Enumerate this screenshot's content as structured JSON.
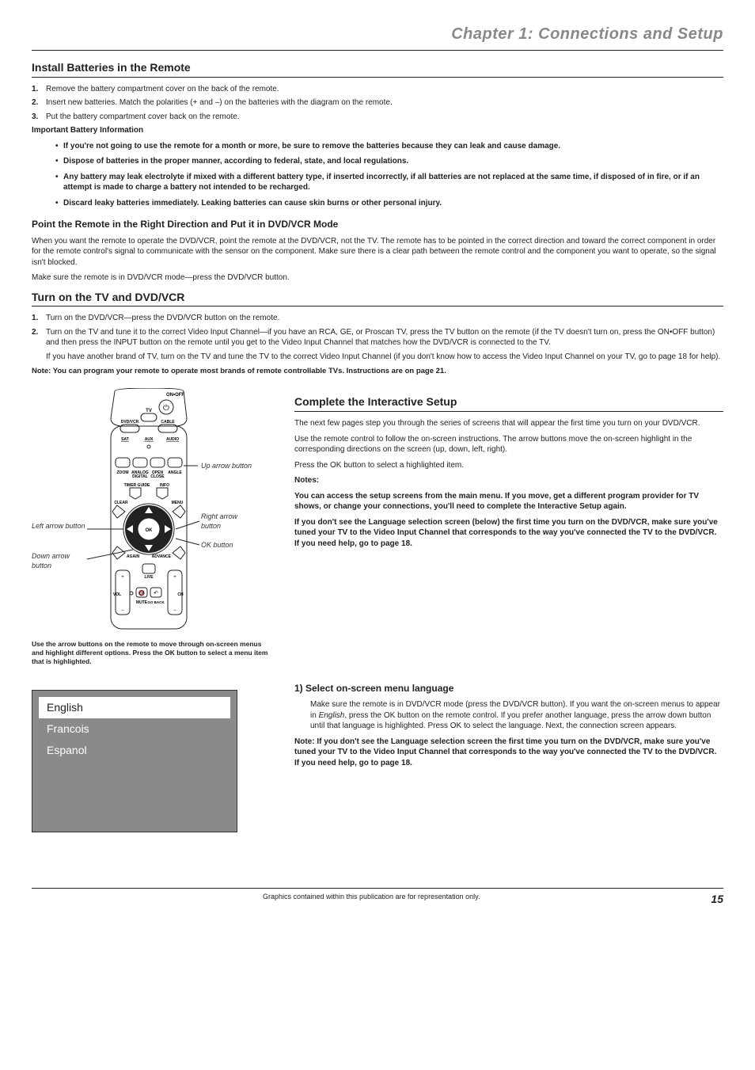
{
  "chapter_title": "Chapter 1: Connections and Setup",
  "sec1": {
    "heading": "Install Batteries in the Remote",
    "steps": [
      "Remove the battery compartment cover on the back of the remote.",
      "Insert new batteries. Match the polarities (+ and –) on the batteries with the diagram on the remote.",
      "Put the battery compartment cover back on the remote."
    ],
    "info_head": "Important Battery Information",
    "bullets": [
      "If you're not going to use the remote for a month or more, be sure to remove the batteries because they can leak and cause damage.",
      "Dispose of batteries in the proper manner, according to federal, state, and local regulations.",
      "Any battery may leak electrolyte if mixed with a different battery type, if inserted incorrectly, if all batteries are not replaced at the same time, if disposed of in fire, or if an attempt is made to charge a battery not intended to be recharged.",
      "Discard leaky batteries immediately. Leaking batteries can cause skin burns or other personal injury."
    ],
    "point_head": "Point the Remote in the Right Direction and Put it in DVD/VCR Mode",
    "point_p1": "When you want the remote to operate the DVD/VCR, point the remote at the DVD/VCR, not the TV. The remote has to be pointed in the correct direction and toward the correct component in order for the remote control's signal to communicate with the sensor on the component. Make sure there is a clear path between the remote control and the component you want to operate, so the signal isn't blocked.",
    "point_p2": "Make sure the remote is in DVD/VCR mode—press the DVD/VCR button."
  },
  "sec2": {
    "heading": "Turn on the TV and DVD/VCR",
    "step1": "Turn on the DVD/VCR—press the DVD/VCR button on the remote.",
    "step2": "Turn on the TV and tune it to the correct Video Input Channel—if you have an RCA, GE, or Proscan TV, press the TV button on the remote (if the TV doesn't turn on, press the ON•OFF button) and then press the INPUT button on the remote until you get to the Video Input Channel that matches how the DVD/VCR is connected to the TV.",
    "step2b": "If you have another brand of TV, turn on the TV and tune the TV to the correct Video Input Channel (if you don't know how to access the Video Input Channel on your TV, go to page 18 for help).",
    "note": "Note: You can program your remote to operate most brands of remote controllable TVs. Instructions are on page 21."
  },
  "remote": {
    "labels": {
      "onoff": "ON•OFF",
      "tv": "TV",
      "dvdvcr": "DVD/VCR",
      "cable": "CABLE",
      "sat": "SAT",
      "aux": "AUX",
      "audio": "AUDIO",
      "zoom": "ZOOM",
      "analog": "ANALOG",
      "digital": "DIGITAL",
      "open": "OPEN",
      "close": "CLOSE",
      "angle": "ANGLE",
      "timerguide": "TIMER GUIDE",
      "info": "INFO",
      "clear": "CLEAR",
      "menu": "MENU",
      "ok": "OK",
      "again": "AGAIN",
      "advance": "ADVANCE",
      "live": "LIVE",
      "vol": "VOL",
      "mute": "MUTE",
      "goback": "GO BACK",
      "ch": "CH",
      "plus": "+",
      "minus": "–"
    },
    "callouts": {
      "up": "Up arrow button",
      "right": "Right arrow button",
      "ok": "OK button",
      "left": "Left arrow button",
      "down": "Down arrow button"
    },
    "caption": "Use the arrow buttons on the remote to move through on-screen menus and highlight different options. Press the OK button to select a menu item that is highlighted."
  },
  "sec3": {
    "heading": "Complete the Interactive Setup",
    "p1": "The next few pages step you through the series of screens that will appear the first time you turn on your DVD/VCR.",
    "p2": "Use the remote control to follow the on-screen instructions. The arrow buttons move the on-screen highlight in the corresponding directions on the screen (up, down, left, right).",
    "p3": "Press the OK button to select a highlighted item.",
    "notes_label": "Notes:",
    "note1": "You can access the setup screens from the main menu. If you move, get a different program provider for TV shows, or change your connections, you'll need to complete the Interactive Setup again.",
    "note2": "If you don't see the Language selection screen (below) the first time you turn on the DVD/VCR, make sure you've tuned your TV to the Video Input Channel that corresponds to the way you've connected the TV to the DVD/VCR. If you need help, go to page 18."
  },
  "lang": {
    "options": [
      "English",
      "Francois",
      "Espanol"
    ],
    "heading": "1) Select on-screen menu language",
    "body_pre": "Make sure the remote is in DVD/VCR mode (press the DVD/VCR button). If you want the on-screen menus to appear in ",
    "body_em": "English",
    "body_post": ", press the OK button on the remote control. If you prefer another language, press the arrow down button until that language is highlighted. Press OK to select the language. Next, the connection screen appears.",
    "note": "Note: If you don't see the Language selection screen the first time you turn on the DVD/VCR, make sure you've tuned your TV to the Video Input Channel that corresponds to the way you've connected the TV to the DVD/VCR. If you need help, go to page 18."
  },
  "footer": {
    "text": "Graphics contained within this publication are for representation only.",
    "page": "15"
  }
}
